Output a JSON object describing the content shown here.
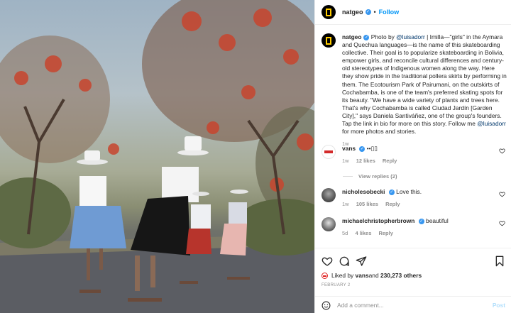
{
  "post": {
    "image_alt": "Photo of four women in pollera skirts and bowler hats skateboarding down a tree-lined road",
    "colors": {
      "brand_yellow": "#ffcc00",
      "link_blue": "#0095f6",
      "verified_blue": "#3897f0",
      "muted": "#8e8e8e"
    }
  },
  "header": {
    "username": "natgeo",
    "verified_icon": "verified-badge-icon",
    "separator": "•",
    "follow_label": "Follow"
  },
  "caption": {
    "username": "natgeo",
    "text_part1": "Photo by ",
    "mention1": "@luisadorr",
    "text_part2": " | Imilla—\"girls\" in the Aymara and Quechua languages—is the name of this skateboarding collective. Their goal is to popularize skateboarding in Bolivia, empower girls, and reconcile cultural differences and century-old stereotypes of Indigenous women along the way. Here they show pride in the traditional pollera skirts by performing in them. The Ecotourism Park of Pairumani, on the outskirts of Cochabamba, is one of the team's preferred skating spots for its beauty. \"We have a wide variety of plants and trees here. That's why Cochabamba is called Ciudad Jardín [Garden City],\" says Daniela Santiváñez, one of the group's founders. Tap the link in bio for more on this story. Follow me ",
    "mention2": "@luisadorr",
    "text_part3": " for more photos and stories.",
    "time": "1w"
  },
  "comments": [
    {
      "username": "vans",
      "text": "••▯▯",
      "time": "1w",
      "likes": "12 likes",
      "reply": "Reply",
      "view_replies": "View replies (2)"
    },
    {
      "username": "nicholesobecki",
      "text": "Love this.",
      "time": "1w",
      "likes": "105 likes",
      "reply": "Reply"
    },
    {
      "username": "michaelchristopherbrown",
      "text": "beautiful",
      "time": "5d",
      "likes": "4 likes",
      "reply": "Reply"
    }
  ],
  "actions": {
    "icons": [
      "heart-icon",
      "comment-icon",
      "share-icon",
      "bookmark-icon"
    ],
    "liked_by_prefix": "Liked by ",
    "liked_by_user": "vans",
    "liked_by_and": " and ",
    "liked_by_count": "230,273 others",
    "date": "FEBRUARY 2"
  },
  "add_comment": {
    "placeholder": "Add a comment...",
    "post_label": "Post",
    "emoji_icon": "emoji-icon"
  }
}
